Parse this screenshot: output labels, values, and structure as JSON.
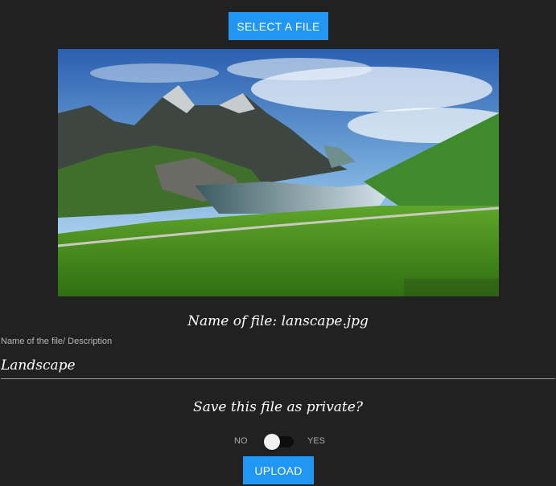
{
  "buttons": {
    "select_file": "SELECT A FILE",
    "upload": "UPLOAD"
  },
  "preview": {
    "alt": "Landscape photo preview"
  },
  "file": {
    "name_text": "Name of file: lanscape.jpg"
  },
  "description_field": {
    "label": "Name of the file/ Description",
    "value": "Landscape"
  },
  "privacy": {
    "question": "Save this file as private?",
    "off_label": "NO",
    "on_label": "YES",
    "is_private": false
  },
  "colors": {
    "background": "#212121",
    "accent": "#2196f3"
  }
}
